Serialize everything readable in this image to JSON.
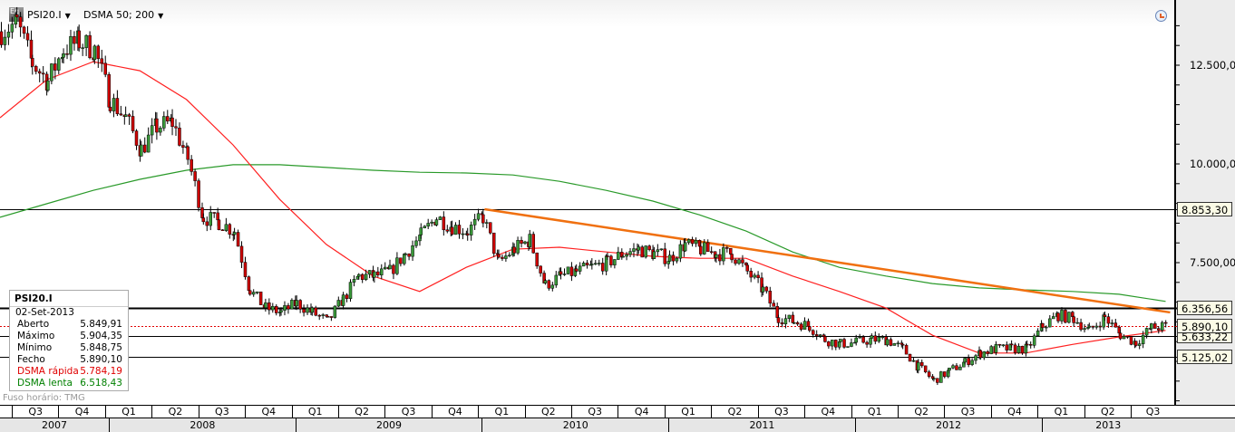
{
  "toolbar": {
    "symbol": "PSI20.I",
    "indicator": "DSMA 50; 200",
    "logo_text": "Eq"
  },
  "info_box": {
    "title": "PSI20.I",
    "date": "02-Set-2013",
    "rows": [
      {
        "label": "Aberto",
        "value": "5.849,91",
        "color": "#000000"
      },
      {
        "label": "Máximo",
        "value": "5.904,35",
        "color": "#000000"
      },
      {
        "label": "Mínimo",
        "value": "5.848,75",
        "color": "#000000"
      },
      {
        "label": "Fecho",
        "value": "5.890,10",
        "color": "#000000"
      },
      {
        "label": "DSMA rápida",
        "value": "5.784,19",
        "color": "#e00000"
      },
      {
        "label": "DSMA lenta",
        "value": "6.518,43",
        "color": "#008000"
      }
    ]
  },
  "timezone": "Fuso horário: TMG",
  "price_axis": {
    "labels": [
      "12.500,00",
      "10.000,00",
      "7.500,00"
    ],
    "ticks": [
      12500,
      10000,
      7500
    ]
  },
  "price_levels": [
    {
      "value": 8853.3,
      "label": "8.853,30",
      "style": "thin"
    },
    {
      "value": 6356.56,
      "label": "6.356,56",
      "style": "thick"
    },
    {
      "value": 5890.1,
      "label": "5.890,10",
      "style": "dotted-red"
    },
    {
      "value": 5633.22,
      "label": "5.633,22",
      "style": "thin"
    },
    {
      "value": 5125.02,
      "label": "5.125,02",
      "style": "thin"
    }
  ],
  "time_axis": {
    "quarters": [
      "Q3",
      "Q4",
      "Q1",
      "Q2",
      "Q3",
      "Q4",
      "Q1",
      "Q2",
      "Q3",
      "Q4",
      "Q1",
      "Q2",
      "Q3",
      "Q4",
      "Q1",
      "Q2",
      "Q3",
      "Q4",
      "Q1",
      "Q2",
      "Q3",
      "Q4",
      "Q1",
      "Q2",
      "Q3"
    ],
    "years": [
      "2007",
      "2008",
      "2009",
      "2010",
      "2011",
      "2012",
      "2013"
    ]
  },
  "chart_data": {
    "type": "candlestick",
    "interval": "weekly",
    "series_colors": {
      "up": "#3a9a3a",
      "down": "#d00000",
      "fast_ma": "#ff2020",
      "slow_ma": "#2a9a2a",
      "trendline": "#f07010"
    },
    "close_monthly": {
      "dates": [
        "2007-06",
        "2007-07",
        "2007-08",
        "2007-09",
        "2007-10",
        "2007-11",
        "2007-12",
        "2008-01",
        "2008-02",
        "2008-03",
        "2008-04",
        "2008-05",
        "2008-06",
        "2008-07",
        "2008-08",
        "2008-09",
        "2008-10",
        "2008-11",
        "2008-12",
        "2009-01",
        "2009-02",
        "2009-03",
        "2009-04",
        "2009-05",
        "2009-06",
        "2009-07",
        "2009-08",
        "2009-09",
        "2009-10",
        "2009-11",
        "2009-12",
        "2010-01",
        "2010-02",
        "2010-03",
        "2010-04",
        "2010-05",
        "2010-06",
        "2010-07",
        "2010-08",
        "2010-09",
        "2010-10",
        "2010-11",
        "2010-12",
        "2011-01",
        "2011-02",
        "2011-03",
        "2011-04",
        "2011-05",
        "2011-06",
        "2011-07",
        "2011-08",
        "2011-09",
        "2011-10",
        "2011-11",
        "2011-12",
        "2012-01",
        "2012-02",
        "2012-03",
        "2012-04",
        "2012-05",
        "2012-06",
        "2012-07",
        "2012-08",
        "2012-09",
        "2012-10",
        "2012-11",
        "2012-12",
        "2013-01",
        "2013-02",
        "2013-03",
        "2013-04",
        "2013-05",
        "2013-06",
        "2013-07",
        "2013-08",
        "2013-09"
      ],
      "values": [
        13350,
        13580,
        12550,
        12100,
        12900,
        13100,
        12900,
        11630,
        11170,
        10370,
        10940,
        11050,
        10140,
        8650,
        8530,
        8300,
        6810,
        6350,
        6240,
        6470,
        6240,
        6010,
        6580,
        7160,
        7160,
        7270,
        7730,
        8190,
        8650,
        8420,
        8300,
        8650,
        7500,
        7840,
        8070,
        6930,
        7160,
        7270,
        7390,
        7500,
        7730,
        7840,
        7730,
        7610,
        7960,
        7840,
        7730,
        7730,
        7270,
        6810,
        6120,
        6010,
        5890,
        5550,
        5440,
        5480,
        5550,
        5550,
        5320,
        4860,
        4520,
        4750,
        4980,
        5210,
        5320,
        5320,
        5320,
        5890,
        6170,
        6080,
        5780,
        6120,
        5670,
        5480,
        5850,
        5890
      ]
    },
    "fast_ma": {
      "name": "DSMA rápida",
      "dates": [
        "2007-06",
        "2007-09",
        "2007-12",
        "2008-03",
        "2008-06",
        "2008-09",
        "2008-12",
        "2009-03",
        "2009-06",
        "2009-09",
        "2009-12",
        "2010-03",
        "2010-06",
        "2010-09",
        "2010-12",
        "2011-03",
        "2011-06",
        "2011-09",
        "2011-12",
        "2012-03",
        "2012-06",
        "2012-09",
        "2012-12",
        "2013-03",
        "2013-06",
        "2013-09"
      ],
      "values": [
        11170,
        12130,
        12590,
        12360,
        11630,
        10480,
        9100,
        7960,
        7160,
        6770,
        7380,
        7840,
        7890,
        7770,
        7660,
        7610,
        7610,
        7160,
        6770,
        6350,
        5660,
        5210,
        5210,
        5430,
        5620,
        5784.19
      ]
    },
    "slow_ma": {
      "name": "DSMA lenta",
      "dates": [
        "2007-06",
        "2007-09",
        "2007-12",
        "2008-03",
        "2008-06",
        "2008-09",
        "2008-12",
        "2009-03",
        "2009-06",
        "2009-09",
        "2009-12",
        "2010-03",
        "2010-06",
        "2010-09",
        "2010-12",
        "2011-03",
        "2011-06",
        "2011-09",
        "2011-12",
        "2012-03",
        "2012-06",
        "2012-09",
        "2012-12",
        "2013-03",
        "2013-06",
        "2013-09"
      ],
      "values": [
        8650,
        8990,
        9330,
        9610,
        9840,
        9980,
        9980,
        9910,
        9840,
        9790,
        9770,
        9720,
        9560,
        9330,
        9060,
        8710,
        8300,
        7770,
        7380,
        7160,
        6970,
        6860,
        6810,
        6770,
        6700,
        6518.43
      ]
    },
    "trendline": {
      "from": {
        "date": "2010-01",
        "value": 8853.3
      },
      "to": {
        "date": "2013-09",
        "value": 6240
      }
    },
    "ylim": [
      3900,
      14000
    ]
  }
}
